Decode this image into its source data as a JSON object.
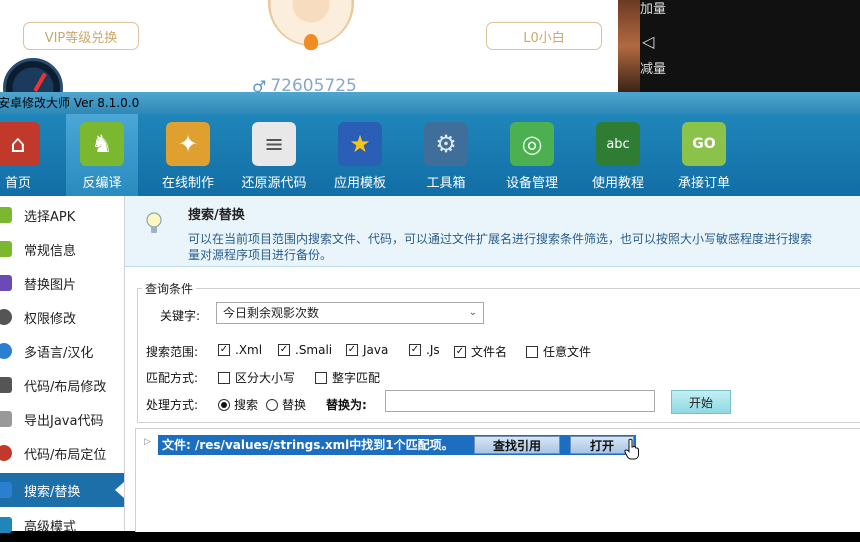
{
  "overlay": {
    "vip_label": "VIP等级兑换",
    "level_label": "L0小白",
    "user_id": "72605725",
    "male_symbol": "♂"
  },
  "volume": {
    "up_label": "加量",
    "icon_symbol": "◁",
    "down_label": "减量"
  },
  "app": {
    "title": "安卓修改大师 Ver 8.1.0.0"
  },
  "toolbar": {
    "items": [
      {
        "label": "首页",
        "icon": "home-icon",
        "color": "#c0392b",
        "glyph": "⌂"
      },
      {
        "label": "反编译",
        "icon": "android-icon",
        "color": "#7cb82f",
        "glyph": "♞"
      },
      {
        "label": "在线制作",
        "icon": "toolbox-icon",
        "color": "#e0a030",
        "glyph": "✦"
      },
      {
        "label": "还原源代码",
        "icon": "document-icon",
        "color": "#dcdcdc",
        "glyph": "≡"
      },
      {
        "label": "应用模板",
        "icon": "star-icon",
        "color": "#2b5fb5",
        "glyph": "★"
      },
      {
        "label": "工具箱",
        "icon": "wrench-icon",
        "color": "#3f6e9a",
        "glyph": "⚙"
      },
      {
        "label": "设备管理",
        "icon": "radar-icon",
        "color": "#4caf50",
        "glyph": "◎"
      },
      {
        "label": "使用教程",
        "icon": "blackboard-icon",
        "color": "#2e7d32",
        "glyph": "abc"
      },
      {
        "label": "承接订单",
        "icon": "shopping-bag-icon",
        "color": "#8bc34a",
        "glyph": "GO"
      }
    ]
  },
  "sidebar": {
    "items": [
      {
        "label": "选择APK",
        "icon": "android-icon",
        "color": "#7cb82f"
      },
      {
        "label": "常规信息",
        "icon": "android-icon",
        "color": "#7cb82f"
      },
      {
        "label": "替换图片",
        "icon": "image-icon",
        "color": "#6a4bb5"
      },
      {
        "label": "权限修改",
        "icon": "gear-icon",
        "color": "#555555"
      },
      {
        "label": "多语言/汉化",
        "icon": "globe-icon",
        "color": "#2a7fd0"
      },
      {
        "label": "代码/布局修改",
        "icon": "monitor-icon",
        "color": "#555555"
      },
      {
        "label": "导出Java代码",
        "icon": "document-icon",
        "color": "#777777"
      },
      {
        "label": "代码/布局定位",
        "icon": "pin-icon",
        "color": "#c0392b"
      },
      {
        "label": "搜索/替换",
        "icon": "search-icon",
        "color": "#2a7fd0"
      },
      {
        "label": "高级模式",
        "icon": "advanced-icon",
        "color": "#1f86b9"
      }
    ]
  },
  "info": {
    "title": "搜索/替换",
    "line1": "可以在当前项目范围内搜索文件、代码，可以通过文件扩展名进行搜索条件筛选，也可以按照大小写敏感程度进行搜索",
    "line2": "量对源程序项目进行备份。"
  },
  "query": {
    "legend": "查询条件",
    "keyword_label": "关键字:",
    "keyword_value": "今日剩余观影次数",
    "scope_label": "搜索范围:",
    "scope_options": [
      {
        "label": ".Xml",
        "checked": "✓"
      },
      {
        "label": ".Smali",
        "checked": "✓"
      },
      {
        "label": "Java",
        "checked": "✓"
      },
      {
        "label": ".Js",
        "checked": "✓"
      },
      {
        "label": "文件名",
        "checked": "✓"
      },
      {
        "label": "任意文件",
        "checked": ""
      }
    ],
    "match_label": "匹配方式:",
    "match_case": "区分大小写",
    "match_whole": "整字匹配",
    "process_label": "处理方式:",
    "mode_search": "搜索",
    "mode_replace": "替换",
    "replace_label": "替换为:",
    "replace_value": "",
    "start_button": "开始"
  },
  "results": {
    "row_text": "文件: /res/values/strings.xml中找到1个匹配项。",
    "find_ref_button": "查找引用",
    "open_button": "打开"
  }
}
